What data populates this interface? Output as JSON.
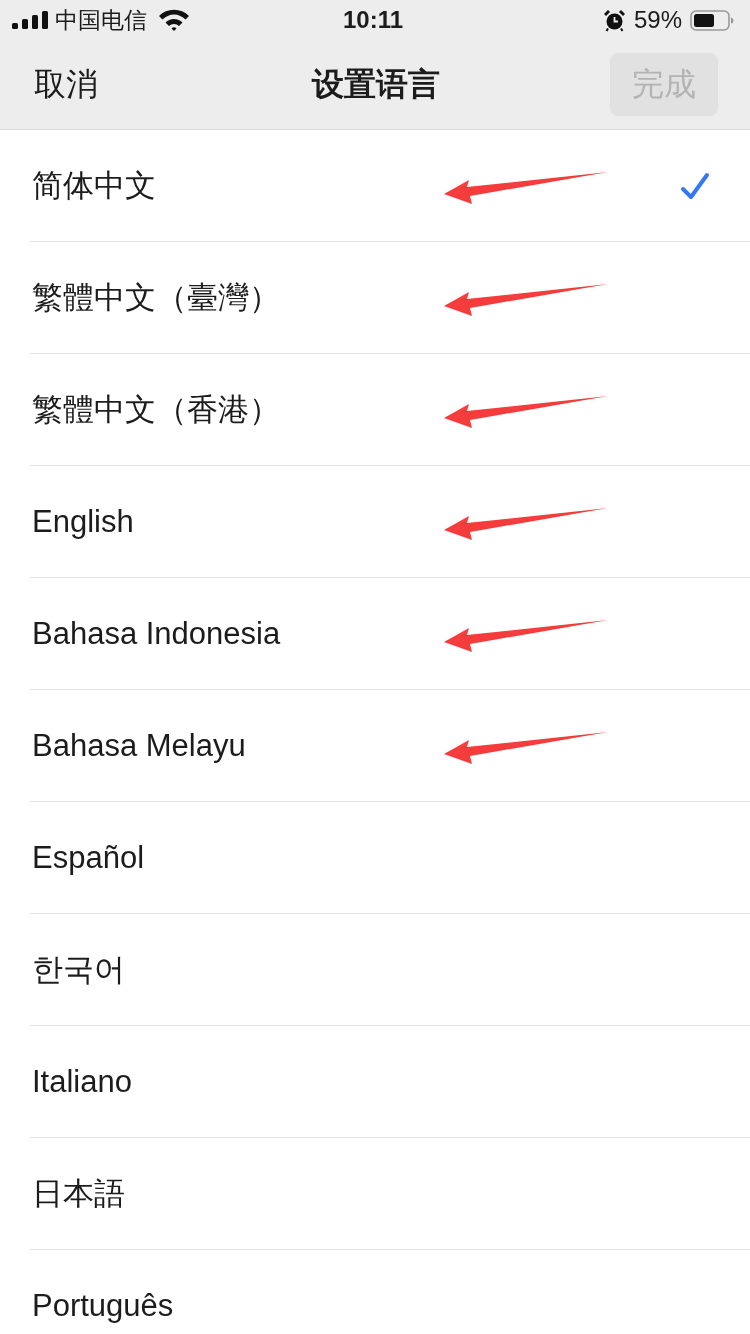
{
  "status_bar": {
    "carrier": "中国电信",
    "time": "10:11",
    "battery": "59%"
  },
  "nav": {
    "cancel": "取消",
    "title": "设置语言",
    "done": {
      "label": "完成",
      "disabled": true
    }
  },
  "languages": [
    {
      "name": "简体中文",
      "selected": true,
      "arrow": true
    },
    {
      "name": "繁體中文（臺灣）",
      "selected": false,
      "arrow": true
    },
    {
      "name": "繁體中文（香港）",
      "selected": false,
      "arrow": true
    },
    {
      "name": "English",
      "selected": false,
      "arrow": true
    },
    {
      "name": "Bahasa Indonesia",
      "selected": false,
      "arrow": true
    },
    {
      "name": "Bahasa Melayu",
      "selected": false,
      "arrow": true
    },
    {
      "name": "Español",
      "selected": false,
      "arrow": false
    },
    {
      "name": "한국어",
      "selected": false,
      "arrow": false
    },
    {
      "name": "Italiano",
      "selected": false,
      "arrow": false
    },
    {
      "name": "日本語",
      "selected": false,
      "arrow": false
    },
    {
      "name": "Português",
      "selected": false,
      "arrow": false
    }
  ]
}
